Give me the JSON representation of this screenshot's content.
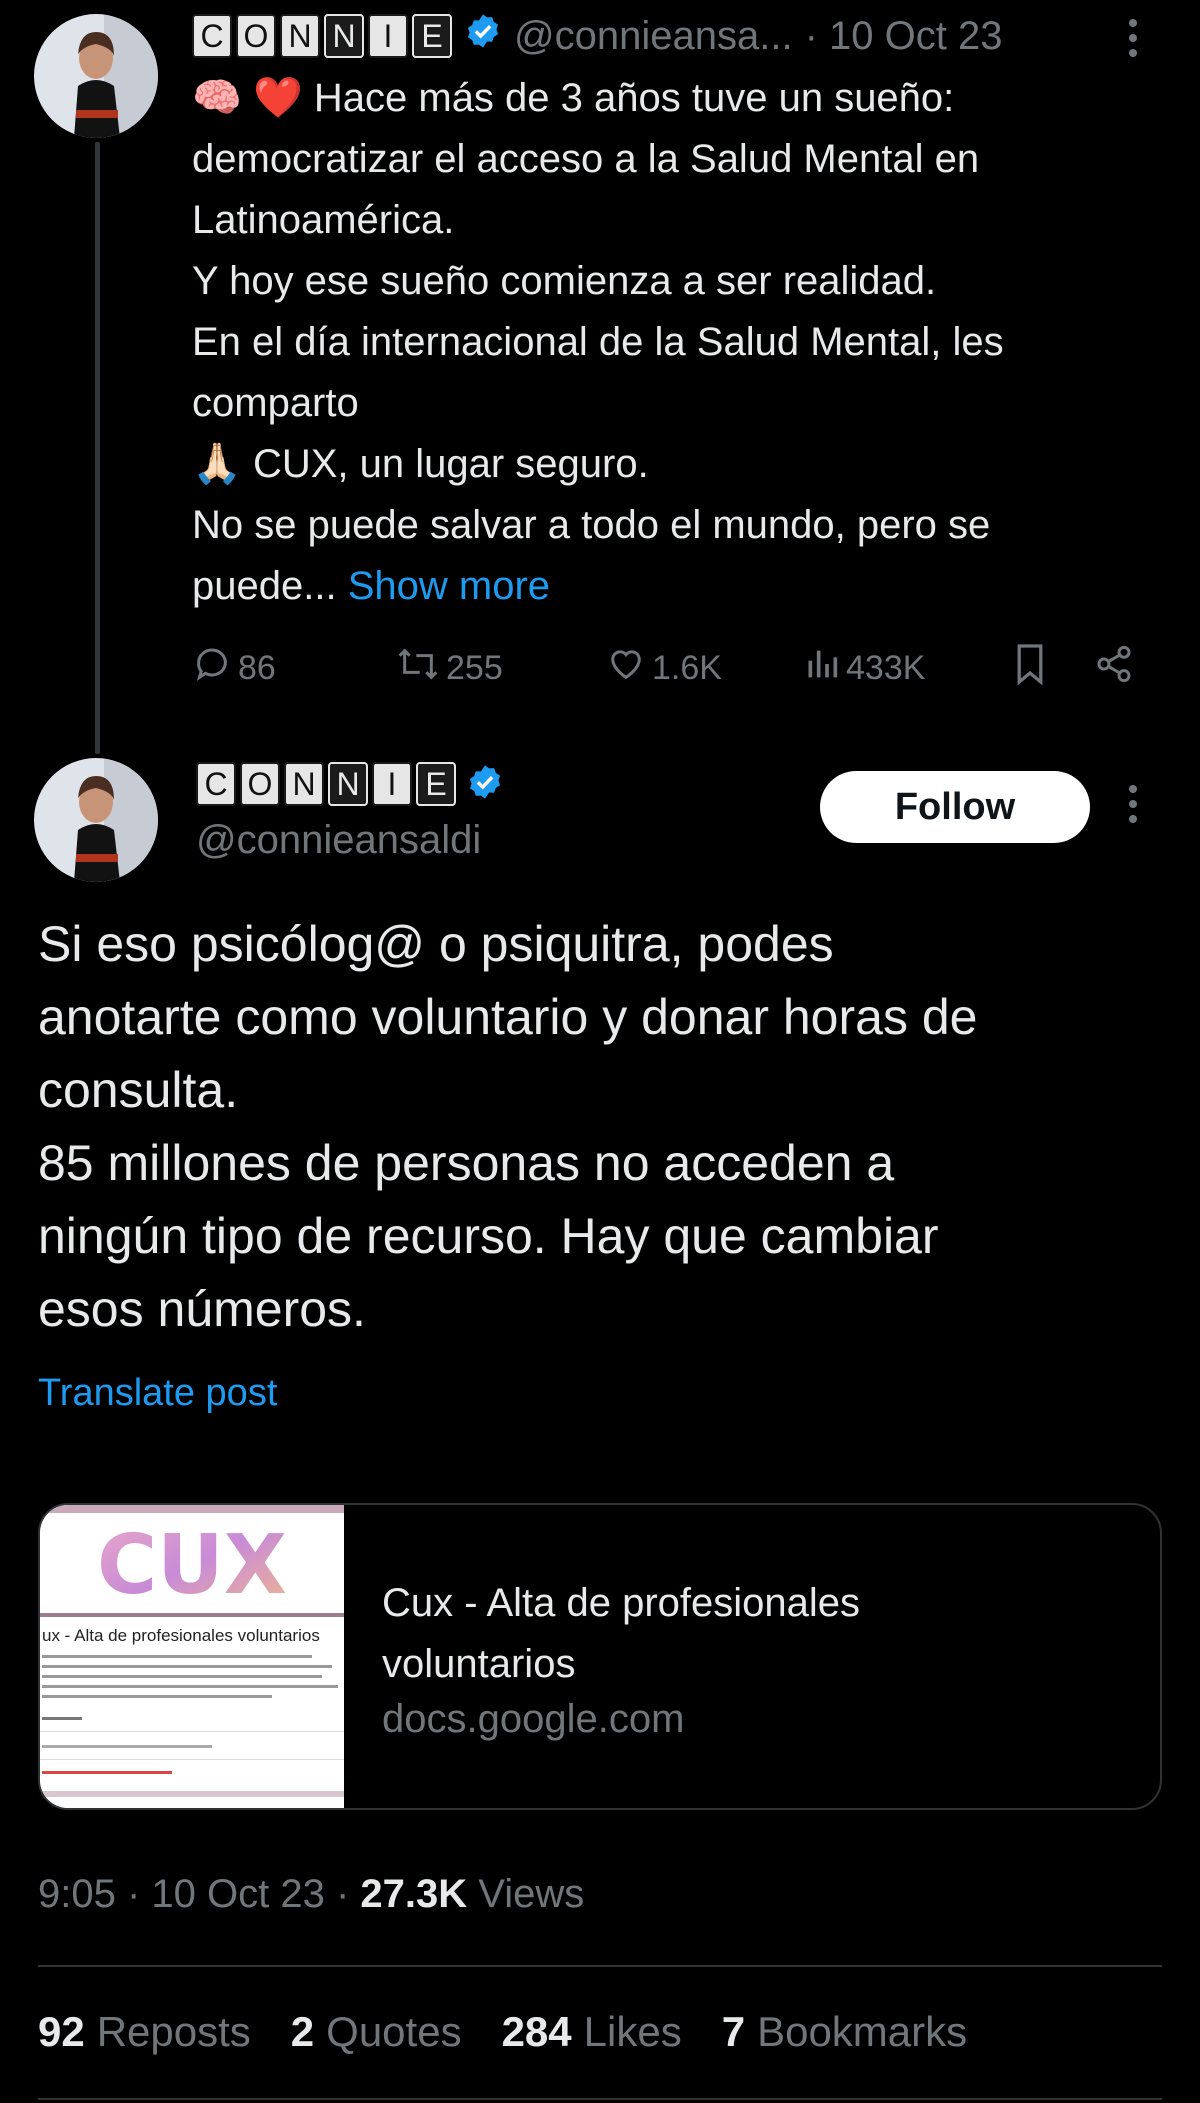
{
  "parent": {
    "name_letters": [
      "C",
      "O",
      "N",
      "N",
      "I",
      "E"
    ],
    "handle": "@connieansa...",
    "date": "· 10 Oct 23",
    "emoji_1": "🧠",
    "emoji_2": "❤️",
    "emoji_3": "🙏🏻",
    "lines": [
      "Hace más de 3 años tuve un sueño:",
      "democratizar el acceso a la Salud Mental en",
      "Latinoamérica.",
      "Y hoy ese sueño comienza a ser realidad.",
      "En el día internacional de la Salud Mental, les",
      "comparto",
      "CUX, un lugar seguro.",
      "No se puede salvar a todo el mundo, pero se",
      "puede..."
    ],
    "show_more": "Show more",
    "replies": "86",
    "reposts": "255",
    "likes": "1.6K",
    "views": "433K"
  },
  "main": {
    "name_letters": [
      "C",
      "O",
      "N",
      "N",
      "I",
      "E"
    ],
    "handle": "@connieansaldi",
    "follow_label": "Follow",
    "lines": [
      "Si eso psicólog@ o psiquitra, podes",
      "anotarte como voluntario y donar horas de",
      "consulta.",
      "85 millones de personas no acceden a",
      "ningún tipo de recurso. Hay que cambiar",
      "esos números."
    ],
    "translate": "Translate post",
    "card": {
      "thumb_logo": "CUX",
      "thumb_heading": "ux - Alta de profesionales voluntarios",
      "title_line1": "Cux - Alta de profesionales",
      "title_line2": "voluntarios",
      "domain": "docs.google.com"
    },
    "time": "9:05 · 10 Oct 23 · ",
    "views_count": "27.3K",
    "views_label": " Views",
    "stats": {
      "reposts_num": "92",
      "reposts_label": "Reposts",
      "quotes_num": "2",
      "quotes_label": "Quotes",
      "likes_num": "284",
      "likes_label": "Likes",
      "bookmarks_num": "7",
      "bookmarks_label": "Bookmarks"
    }
  },
  "colors": {
    "accent": "#1d9bf0",
    "muted": "#71767b",
    "text": "#e7e9ea",
    "background": "#000000"
  }
}
